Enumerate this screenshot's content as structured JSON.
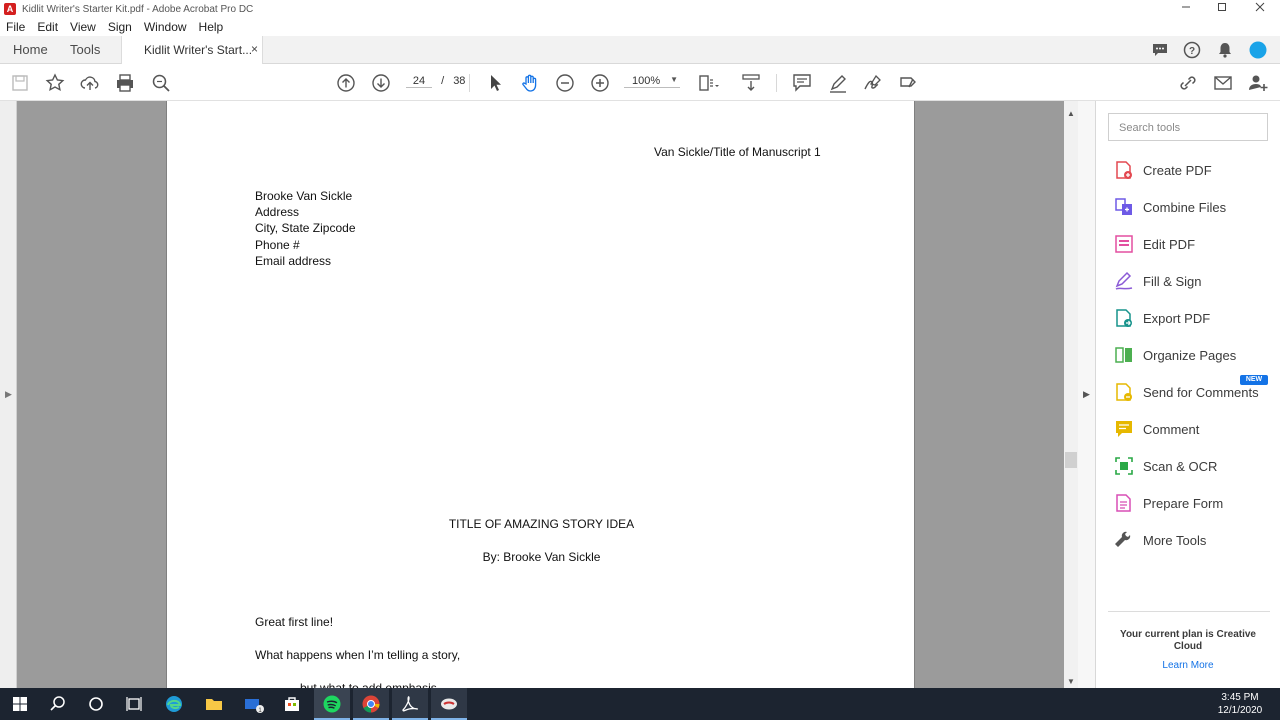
{
  "window": {
    "title": "Kidlit Writer's Starter Kit.pdf - Adobe Acrobat Pro DC",
    "app_icon_glyph": "A"
  },
  "menu": [
    "File",
    "Edit",
    "View",
    "Sign",
    "Window",
    "Help"
  ],
  "tabs": {
    "home": "Home",
    "tools": "Tools",
    "document": "Kidlit Writer's Start...",
    "close": "×"
  },
  "toolbar": {
    "current_page": "24",
    "separator": "/",
    "total_pages": "38",
    "zoom": "100%"
  },
  "document": {
    "header": "Van Sickle/Title of Manuscript 1",
    "address_lines": [
      "Brooke Van Sickle",
      "Address",
      "City, State Zipcode",
      "Phone #",
      "Email address"
    ],
    "story_title": "TITLE OF AMAZING STORY IDEA",
    "byline": "By: Brooke Van Sickle",
    "body_lines": [
      "Great first line!",
      "What happens when I’m telling a story,",
      "but what to add emphasis"
    ]
  },
  "tools_pane": {
    "search_placeholder": "Search tools",
    "items": [
      {
        "label": "Create PDF",
        "color": "#e34850"
      },
      {
        "label": "Combine Files",
        "color": "#6e5ae6"
      },
      {
        "label": "Edit PDF",
        "color": "#e34fa0"
      },
      {
        "label": "Fill & Sign",
        "color": "#8b5ad6"
      },
      {
        "label": "Export PDF",
        "color": "#17938c"
      },
      {
        "label": "Organize Pages",
        "color": "#4caf50"
      },
      {
        "label": "Send for Comments",
        "color": "#e6b800"
      },
      {
        "label": "Comment",
        "color": "#e6b800"
      },
      {
        "label": "Scan & OCR",
        "color": "#2aa846"
      },
      {
        "label": "Prepare Form",
        "color": "#d84fb5"
      },
      {
        "label": "More Tools",
        "color": "#555555"
      }
    ],
    "new_badge": "NEW",
    "plan_text": "Your current plan is Creative Cloud",
    "learn_more": "Learn More"
  },
  "taskbar": {
    "time": "3:45 PM",
    "date": "12/1/2020"
  }
}
